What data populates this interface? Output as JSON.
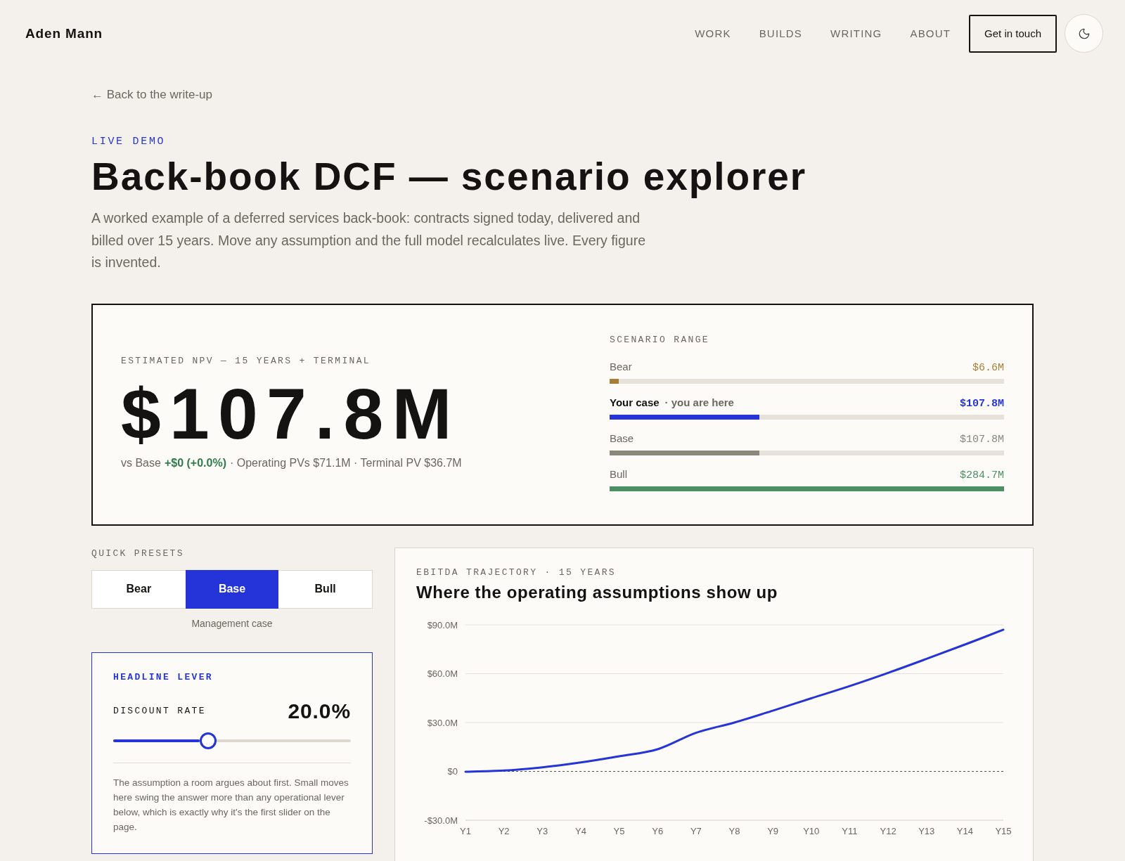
{
  "header": {
    "logo": "Aden Mann",
    "nav": [
      {
        "label": "WORK",
        "selected": false
      },
      {
        "label": "BUILDS",
        "selected": false
      },
      {
        "label": "WRITING",
        "selected": false
      },
      {
        "label": "ABOUT",
        "selected": false
      }
    ],
    "cta": "Get in touch"
  },
  "back_link": "← Back to the write-up",
  "hero": {
    "eyebrow": "LIVE DEMO",
    "title": "Back-book DCF — scenario explorer",
    "intro": "A worked example of a deferred services back-book: contracts signed today, delivered and billed over 15 years. Move any assumption and the full model recalculates live. Every figure is invented."
  },
  "npv_card": {
    "label": "ESTIMATED NPV — 15 YEARS + TERMINAL",
    "value": "$107.8M",
    "comparison": {
      "prefix": "vs Base",
      "delta": "+$0 (+0.0%)",
      "detail": "· Operating PVs $71.1M · Terminal PV $36.7M"
    }
  },
  "scenario_range": {
    "title": "SCENARIO RANGE",
    "rows": [
      {
        "label": "Bear",
        "value": "$6.6M",
        "level": 0.023,
        "color": "#a87e35",
        "emphasized": false
      },
      {
        "label": "Your case",
        "note": "· you are here",
        "value": "$107.8M",
        "level": 0.379,
        "color": "#2434d8",
        "emphasized": true
      },
      {
        "label": "Base",
        "value": "$107.8M",
        "level": 0.379,
        "color": "#8a877b",
        "emphasized": false
      },
      {
        "label": "Bull",
        "value": "$284.7M",
        "level": 1,
        "color": "#4b8f63",
        "emphasized": false
      }
    ]
  },
  "presets": {
    "title": "QUICK PRESETS",
    "items": [
      {
        "label": "Bear",
        "selected": false
      },
      {
        "label": "Base",
        "selected": true
      },
      {
        "label": "Bull",
        "selected": false
      }
    ],
    "caption": "Management case"
  },
  "lever": {
    "eyebrow": "HEADLINE LEVER",
    "name": "DISCOUNT RATE",
    "value": "20.0%",
    "level": 0.4,
    "description": "The assumption a room argues about first. Small moves here swing the answer more than any operational lever below, which is exactly why it's the first slider on the page."
  },
  "ebitda": {
    "eyebrow": "EBITDA TRAJECTORY · 15 YEARS",
    "chart_data": {
      "type": "line",
      "title": "Where the operating assumptions show up",
      "categories": [
        "Y1",
        "Y2",
        "Y3",
        "Y4",
        "Y5",
        "Y6",
        "Y7",
        "Y8",
        "Y9",
        "Y10",
        "Y11",
        "Y12",
        "Y13",
        "Y14",
        "Y15"
      ],
      "series": [
        {
          "color": "#2434d8",
          "values": [
            -0.2,
            0.5,
            2.5,
            5.5,
            9.3,
            13.6,
            23.7,
            30.0,
            37.3,
            44.9,
            52.4,
            60.5,
            69.1,
            77.9,
            87.0
          ]
        }
      ],
      "ylim": [
        -30,
        90
      ],
      "yticks": [
        {
          "value": -30,
          "label": "-$30.0M"
        },
        {
          "value": 0,
          "label": "$0"
        },
        {
          "value": 30,
          "label": "$30.0M"
        },
        {
          "value": 60,
          "label": "$60.0M"
        },
        {
          "value": 90,
          "label": "$90.0M"
        }
      ],
      "ref_lines": [
        {
          "axis": "y",
          "value": 0
        }
      ]
    }
  }
}
